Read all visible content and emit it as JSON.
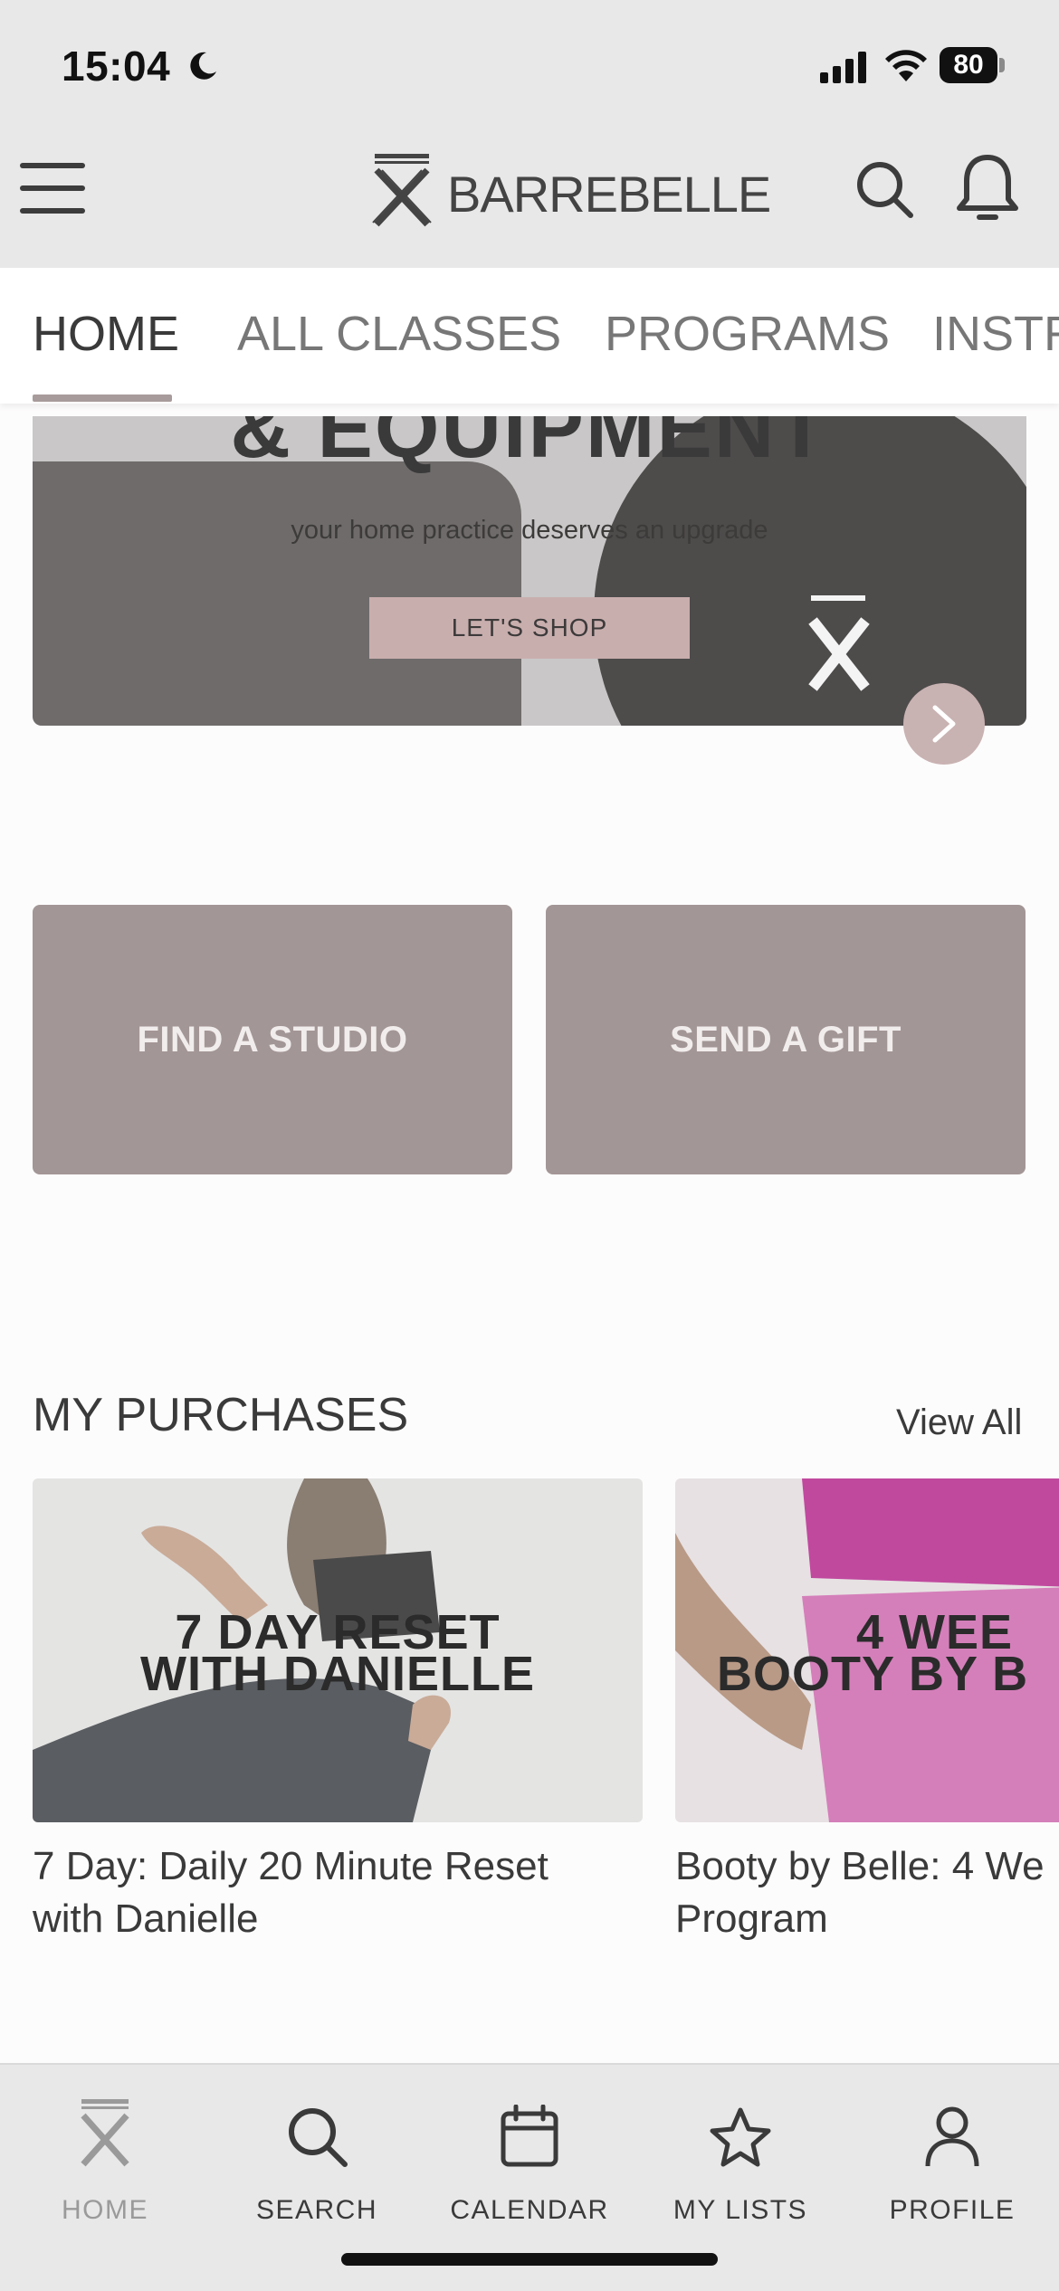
{
  "status_bar": {
    "time": "15:04",
    "battery": "80"
  },
  "header": {
    "brand": "BARREBELLE"
  },
  "tabs": [
    {
      "label": "HOME",
      "active": true
    },
    {
      "label": "ALL CLASSES",
      "active": false
    },
    {
      "label": "PROGRAMS",
      "active": false
    },
    {
      "label": "INSTR",
      "active": false
    }
  ],
  "hero": {
    "heading": "& EQUIPMENT",
    "subtitle": "your home practice deserves an upgrade",
    "button": "LET'S SHOP"
  },
  "tiles": [
    {
      "label": "FIND A STUDIO"
    },
    {
      "label": "SEND A GIFT"
    }
  ],
  "purchases": {
    "title": "MY PURCHASES",
    "view_all": "View All",
    "items": [
      {
        "overlay_line1": "7 DAY RESET",
        "overlay_line2": "WITH DANIELLE",
        "title_line1": "7 Day: Daily 20 Minute Reset",
        "title_line2": "with Danielle"
      },
      {
        "overlay_line1": "4 WEE",
        "overlay_line2": "BOOTY BY B",
        "title_line1": "Booty by Belle: 4 We",
        "title_line2": "Program"
      }
    ]
  },
  "bottom_nav": [
    {
      "label": "HOME",
      "icon": "barrebelle-logo-icon",
      "active": true
    },
    {
      "label": "SEARCH",
      "icon": "search-icon",
      "active": false
    },
    {
      "label": "CALENDAR",
      "icon": "calendar-icon",
      "active": false
    },
    {
      "label": "MY LISTS",
      "icon": "star-icon",
      "active": false
    },
    {
      "label": "PROFILE",
      "icon": "person-icon",
      "active": false
    }
  ],
  "colors": {
    "accent": "#a89b9b",
    "tile": "#a39696",
    "hero_button": "#c9aeae",
    "header_bg": "#e8e8e8"
  }
}
